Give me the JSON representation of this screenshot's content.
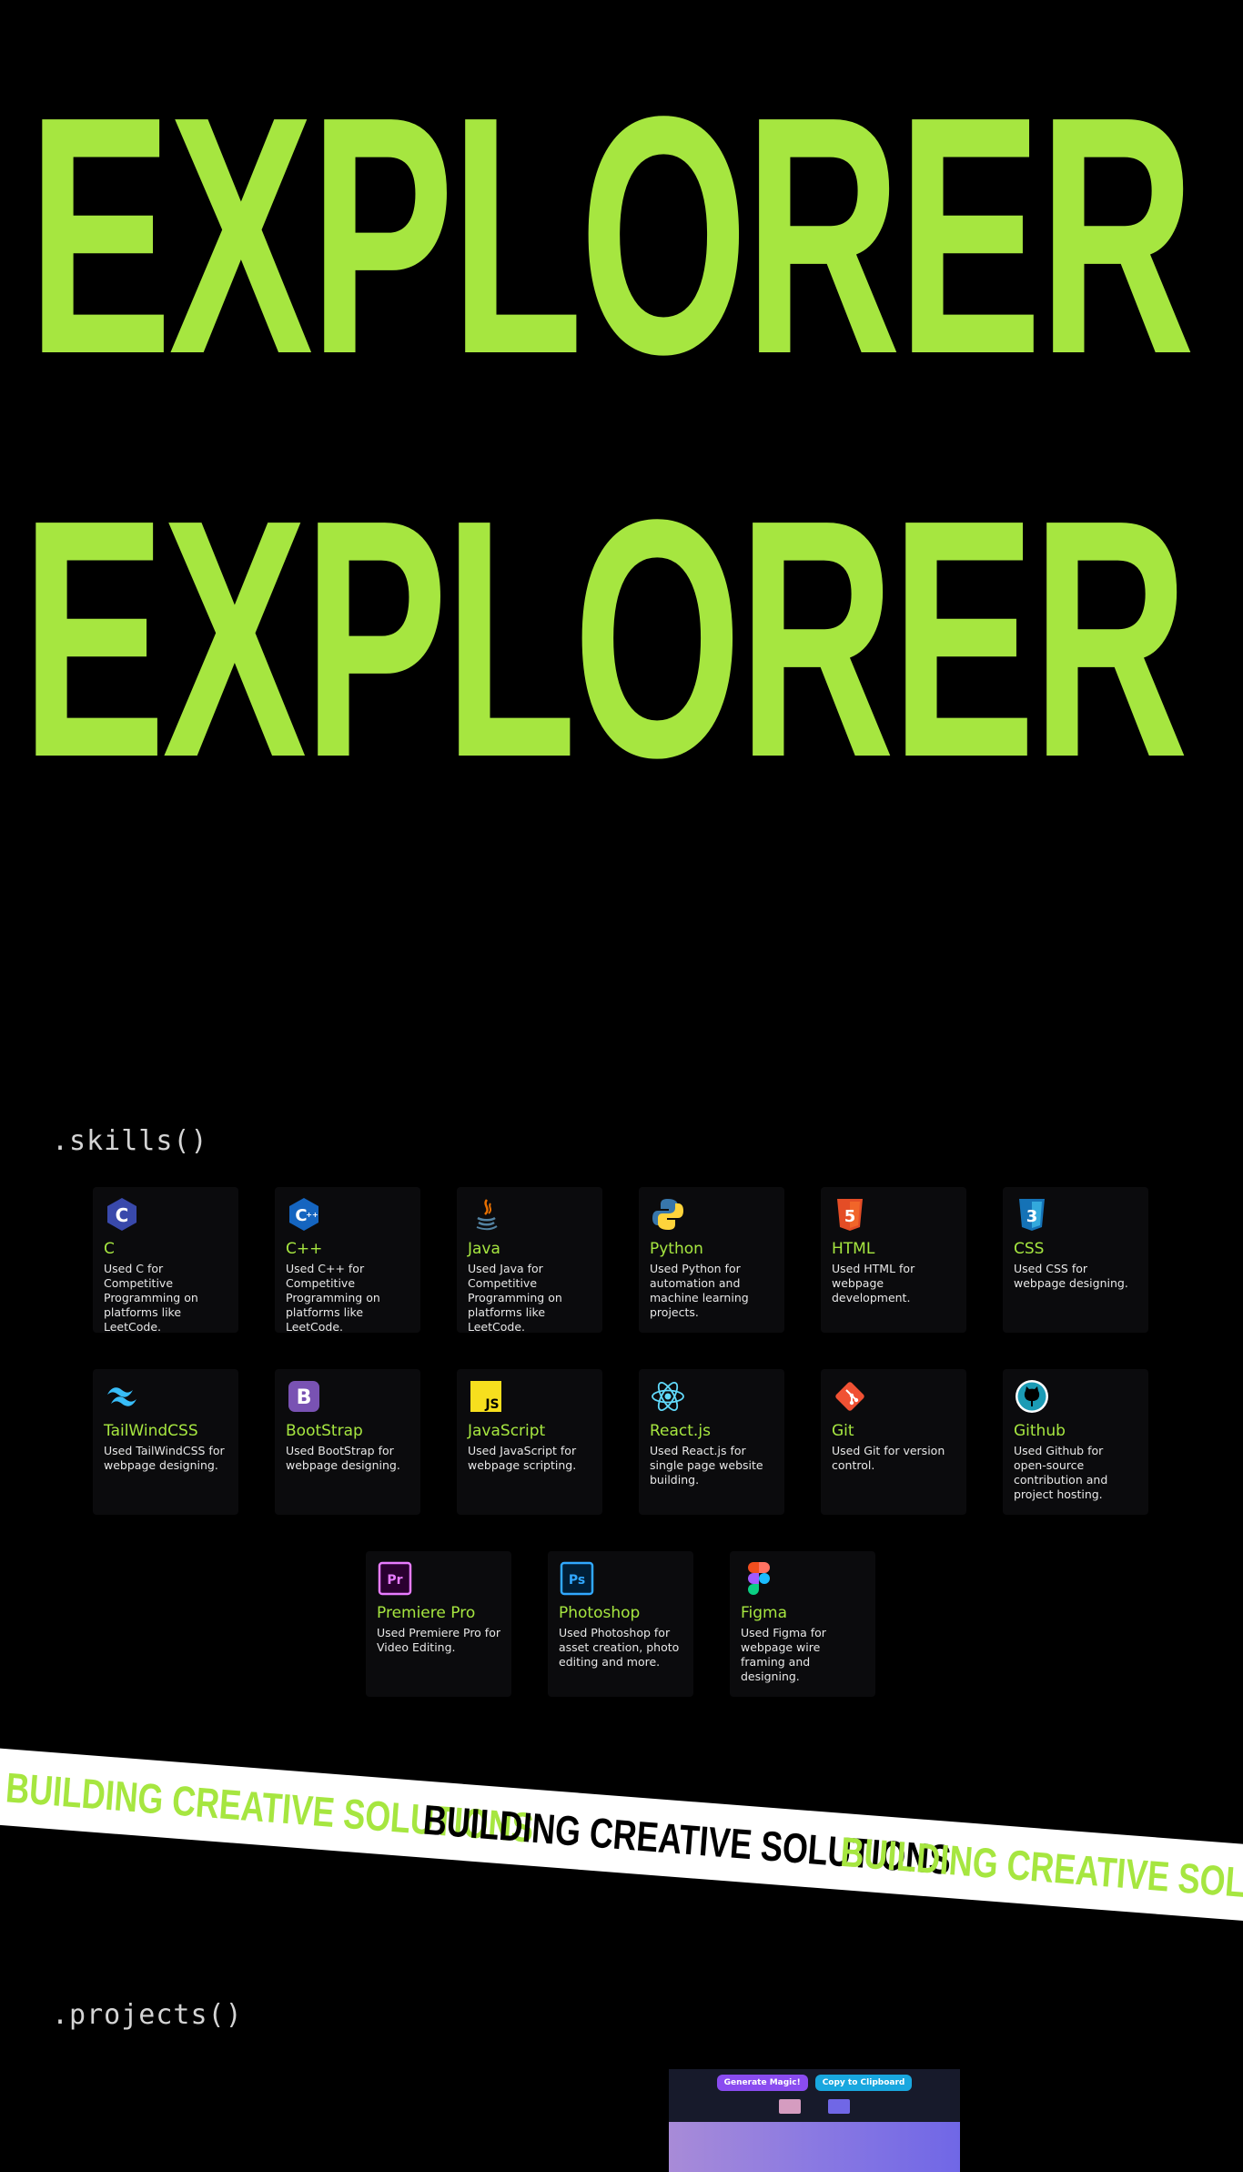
{
  "hero": {
    "line1": "R EXPLORER",
    "line2": "R EXPLORER",
    "color": "#a6e640"
  },
  "skills_section": {
    "title": ".skills()",
    "cards": [
      {
        "name": "C",
        "desc": "Used C for Competitive Programming on platforms like LeetCode.",
        "icon": "c-language-icon"
      },
      {
        "name": "C++",
        "desc": "Used C++ for Competitive Programming on platforms like LeetCode.",
        "icon": "cpp-icon"
      },
      {
        "name": "Java",
        "desc": "Used Java for Competitive Programming on platforms like LeetCode.",
        "icon": "java-icon"
      },
      {
        "name": "Python",
        "desc": "Used Python for automation and machine learning projects.",
        "icon": "python-icon"
      },
      {
        "name": "HTML",
        "desc": "Used HTML for webpage development.",
        "icon": "html5-icon"
      },
      {
        "name": "CSS",
        "desc": "Used CSS for webpage designing.",
        "icon": "css3-icon"
      },
      {
        "name": "TailWindCSS",
        "desc": "Used TailWindCSS for webpage designing.",
        "icon": "tailwind-icon"
      },
      {
        "name": "BootStrap",
        "desc": "Used BootStrap for webpage designing.",
        "icon": "bootstrap-icon"
      },
      {
        "name": "JavaScript",
        "desc": "Used JavaScript for webpage scripting.",
        "icon": "javascript-icon"
      },
      {
        "name": "React.js",
        "desc": "Used React.js for single page website building.",
        "icon": "react-icon"
      },
      {
        "name": "Git",
        "desc": "Used Git for version control.",
        "icon": "git-icon"
      },
      {
        "name": "Github",
        "desc": "Used Github for open-source contribution and project hosting.",
        "icon": "github-icon"
      },
      {
        "name": "Premiere Pro",
        "desc": "Used Premiere Pro for Video Editing.",
        "icon": "premiere-pro-icon"
      },
      {
        "name": "Photoshop",
        "desc": "Used Photoshop for asset creation, photo editing and more.",
        "icon": "photoshop-icon"
      },
      {
        "name": "Figma",
        "desc": "Used Figma for webpage wire framing and designing.",
        "icon": "figma-icon"
      }
    ]
  },
  "banner": {
    "text1": "BUILDING CREATIVE SOLUTIONS",
    "text2": "BUILDING CREATIVE SOLUTIONS",
    "text3": "BUILDING CREATIVE SOLUTIONS"
  },
  "projects_section": {
    "title": ".projects()",
    "preview": {
      "button_generate": "Generate Magic!",
      "button_copy": "Copy to Clipboard",
      "swatch1_color": "#d59cc0",
      "swatch2_color": "#7067e6"
    }
  }
}
